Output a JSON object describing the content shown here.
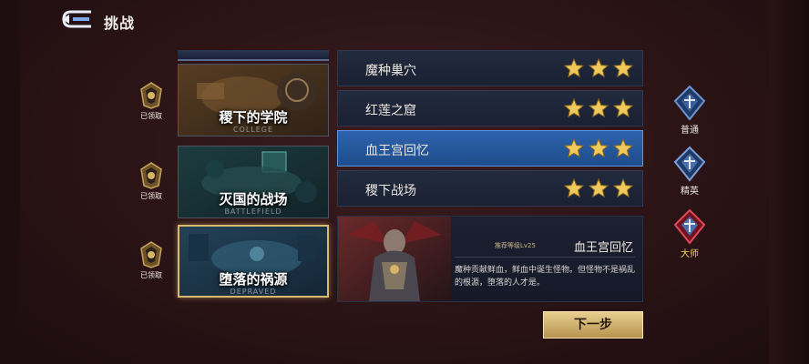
{
  "header": {
    "title": "挑战"
  },
  "badges": [
    {
      "label": "已领取"
    },
    {
      "label": "已领取"
    },
    {
      "label": "已领取"
    }
  ],
  "maps": [
    {
      "name": "稷下的学院",
      "subtitle": "COLLEGE"
    },
    {
      "name": "灭国的战场",
      "subtitle": "BATTLEFIELD"
    },
    {
      "name": "堕落的祸源",
      "subtitle": "DEPRAVED",
      "selected": true
    }
  ],
  "stages": [
    {
      "name": "魔种巢穴",
      "stars": 3
    },
    {
      "name": "红莲之窟",
      "stars": 3
    },
    {
      "name": "血王宫回忆",
      "stars": 3,
      "active": true
    },
    {
      "name": "稷下战场",
      "stars": 3
    }
  ],
  "detail": {
    "recommend": "推荐等级Lv25",
    "name": "血王宫回忆",
    "description": "魔种贡献鲜血，鲜血中诞生怪物。但怪物不是祸乱的根源，堕落的人才是。"
  },
  "next_button": "下一步",
  "difficulties": [
    {
      "label": "普通"
    },
    {
      "label": "精英"
    },
    {
      "label": "大师",
      "active": true
    }
  ],
  "colors": {
    "accent_gold": "#e6c57a",
    "active_stage": "#2d63ad",
    "master_red": "#c52a3a",
    "normal_blue": "#3b5f9c"
  },
  "icons": {
    "back": "back-arrow-icon",
    "badge": "gold-crest-icon",
    "star": "gold-star-icon",
    "difficulty": "diamond-crest-icon"
  }
}
